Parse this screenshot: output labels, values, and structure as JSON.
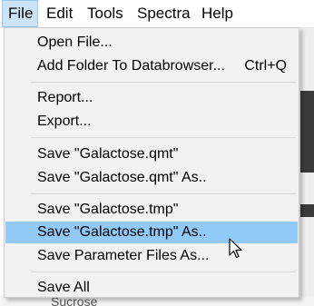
{
  "menubar": {
    "items": [
      {
        "label": "File"
      },
      {
        "label": "Edit"
      },
      {
        "label": "Tools"
      },
      {
        "label": "Spectra"
      },
      {
        "label": "Help"
      }
    ]
  },
  "file_menu": {
    "open_file": "Open File...",
    "add_folder": "Add Folder To Databrowser...",
    "add_folder_shortcut": "Ctrl+Q",
    "report": "Report...",
    "export": "Export...",
    "save_qmt": "Save \"Galactose.qmt\"",
    "save_qmt_as": "Save \"Galactose.qmt\" As..",
    "save_tmp": "Save \"Galactose.tmp\"",
    "save_tmp_as": "Save \"Galactose.tmp\" As..",
    "save_param": "Save Parameter Files As...",
    "save_all": "Save All"
  },
  "background": {
    "partial_text": "Sucrose"
  },
  "colors": {
    "highlight": "#91c9f7",
    "menubar_active": "#cce4f7"
  }
}
